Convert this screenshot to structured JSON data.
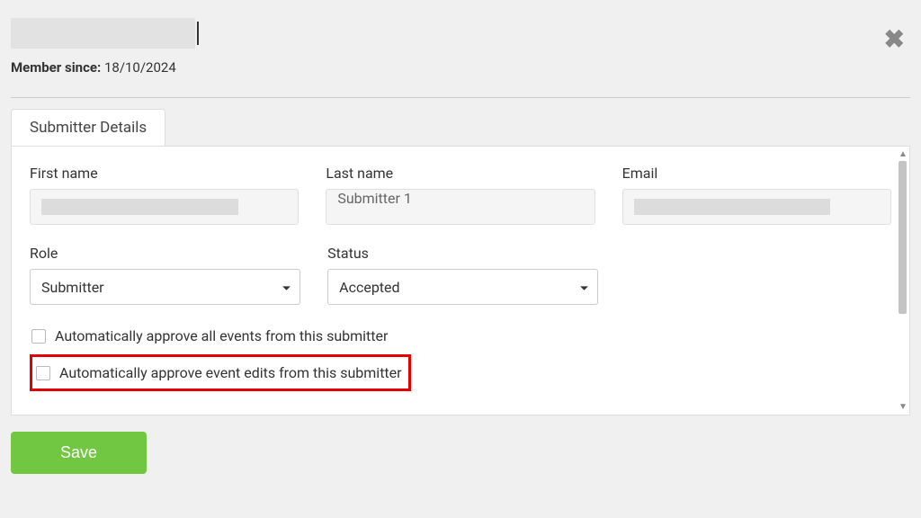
{
  "header": {
    "member_since_label": "Member since:",
    "member_since_value": "18/10/2024"
  },
  "tabs": {
    "submitter_details": "Submitter Details"
  },
  "form": {
    "first_name": {
      "label": "First name",
      "value": ""
    },
    "last_name": {
      "label": "Last name",
      "value": "Submitter 1"
    },
    "email": {
      "label": "Email",
      "value": ""
    },
    "role": {
      "label": "Role",
      "selected": "Submitter"
    },
    "status": {
      "label": "Status",
      "selected": "Accepted"
    },
    "auto_approve_events_label": "Automatically approve all events from this submitter",
    "auto_approve_edits_label": "Automatically approve event edits from this submitter"
  },
  "actions": {
    "save": "Save"
  },
  "close_symbol": "✖"
}
